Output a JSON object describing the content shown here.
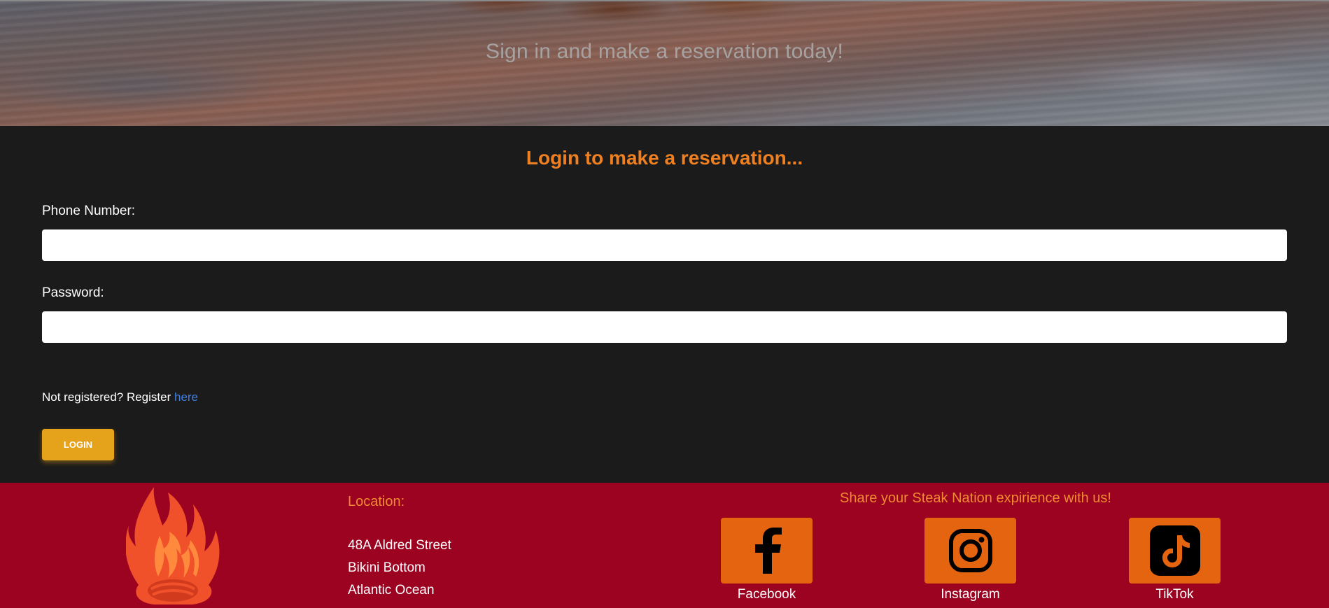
{
  "hero": {
    "tagline": "Sign in and make a reservation today!"
  },
  "login": {
    "title": "Login to make a reservation...",
    "phone_label": "Phone Number:",
    "phone_value": "",
    "password_label": "Password:",
    "password_value": "",
    "register_prefix": "Not registered? Register ",
    "register_link": "here",
    "login_button": "LOGIN"
  },
  "footer": {
    "location_title": "Location:",
    "address": [
      "48A Aldred Street",
      "Bikini Bottom",
      "Atlantic Ocean"
    ],
    "share_title": "Share your Steak Nation expirience with us!",
    "social": [
      {
        "label": "Facebook",
        "icon": "facebook-icon"
      },
      {
        "label": "Instagram",
        "icon": "instagram-icon"
      },
      {
        "label": "TikTok",
        "icon": "tiktok-icon"
      }
    ]
  },
  "colors": {
    "accent_orange": "#ef8021",
    "button_gold": "#e5a21b",
    "footer_red": "#9b0320",
    "social_orange": "#e4640f",
    "link_blue": "#3f7fe3",
    "dark_bg": "#1b1b1b"
  }
}
